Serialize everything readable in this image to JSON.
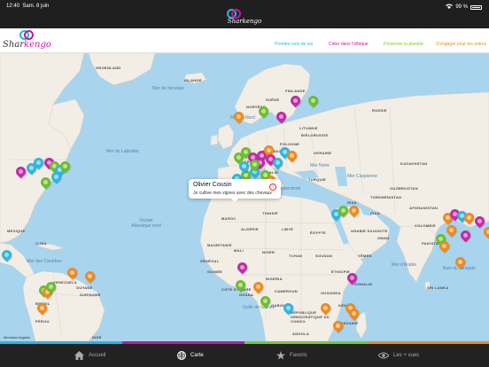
{
  "status": {
    "time": "12:40",
    "date": "Sam. 8 juin",
    "battery": "99 %"
  },
  "app": {
    "name": "Sharkengo",
    "brand_part1": "Shar",
    "brand_part2": "kengo"
  },
  "nav_links": [
    {
      "label": "Prendre soin de soi",
      "color": "#27b6e3"
    },
    {
      "label": "Créer dans l'éthique",
      "color": "#c2189b"
    },
    {
      "label": "Préserver la planète",
      "color": "#7cc92c"
    },
    {
      "label": "S'engager pour les autres",
      "color": "#f08a1c"
    }
  ],
  "pin_colors": {
    "blue": "#2fb6de",
    "magenta": "#c42aa8",
    "green": "#6cc02b",
    "orange": "#f08a1c"
  },
  "map_labels": {
    "oceans": [
      {
        "text": "Océan\nAtlantique nord"
      },
      {
        "text": "Mer du Labrador"
      }
    ],
    "countries": [
      "RUSSIE",
      "KAZAKHSTAN",
      "UKRAINE",
      "POLOGNE",
      "ALLEMAGNE",
      "FRANCE",
      "ESPAGNE",
      "ITALIE",
      "TURQUIE",
      "IRAN",
      "IRAK",
      "ARABIE SAOUDITE",
      "ÉGYPTE",
      "LIBYE",
      "ALGÉRIE",
      "MAROC",
      "TUNISIE",
      "MALI",
      "NIGER",
      "TCHAD",
      "SOUDAN",
      "NIGERIA",
      "ÉTHIOPIE",
      "KENYA",
      "TANZANIE",
      "ANGOLA",
      "RÉPUBLIQUE DÉMOCRATIQUE DU CONGO",
      "INDE",
      "PAKISTAN",
      "COLOMBIE",
      "VENEZUELA",
      "BRÉSIL",
      "PÉROU",
      "CUBA",
      "MEXIQUE",
      "GROENLAND",
      "ISLANDE",
      "FINLANDE",
      "SUÈDE",
      "NORVÈGE",
      "BIÉLORUSSIE",
      "LITUANIE",
      "MAURITANIE",
      "SÉNÉGAL",
      "GUINÉE",
      "CÔTE D'IVOIRE",
      "GHANA",
      "CAMEROUN",
      "GABON",
      "OUGANDA",
      "SOMALIE",
      "YÉMEN",
      "OMAN",
      "OUZBÉKISTAN",
      "TURKMÉNISTAN",
      "AFGHANISTAN",
      "SRI LANKA",
      "SURINAME",
      "GUYANE"
    ],
    "seas": [
      "Mer Noire",
      "Mer Caspienne",
      "Mer Méditerranée",
      "Mer Rouge",
      "Golfe de Guinée",
      "Mer des Caraïbes",
      "Mer d'Arabie",
      "Baie du Bengale",
      "Mer du Nord",
      "Mer de Norvège"
    ]
  },
  "callout": {
    "name": "Olivier Cousin",
    "description": "Je cultive mes vignes avec des chevaux",
    "info_symbol": "i"
  },
  "legal": "Mentions légales",
  "tabs": [
    {
      "label": "Accueil",
      "icon": "home-icon"
    },
    {
      "label": "Carte",
      "icon": "globe-icon"
    },
    {
      "label": "Favoris",
      "icon": "star-icon"
    },
    {
      "label": "Les + vues",
      "icon": "eye-icon"
    }
  ],
  "stripe_colors": [
    "#27b6e3",
    "#c2189b",
    "#7cc92c",
    "#f08a1c"
  ]
}
